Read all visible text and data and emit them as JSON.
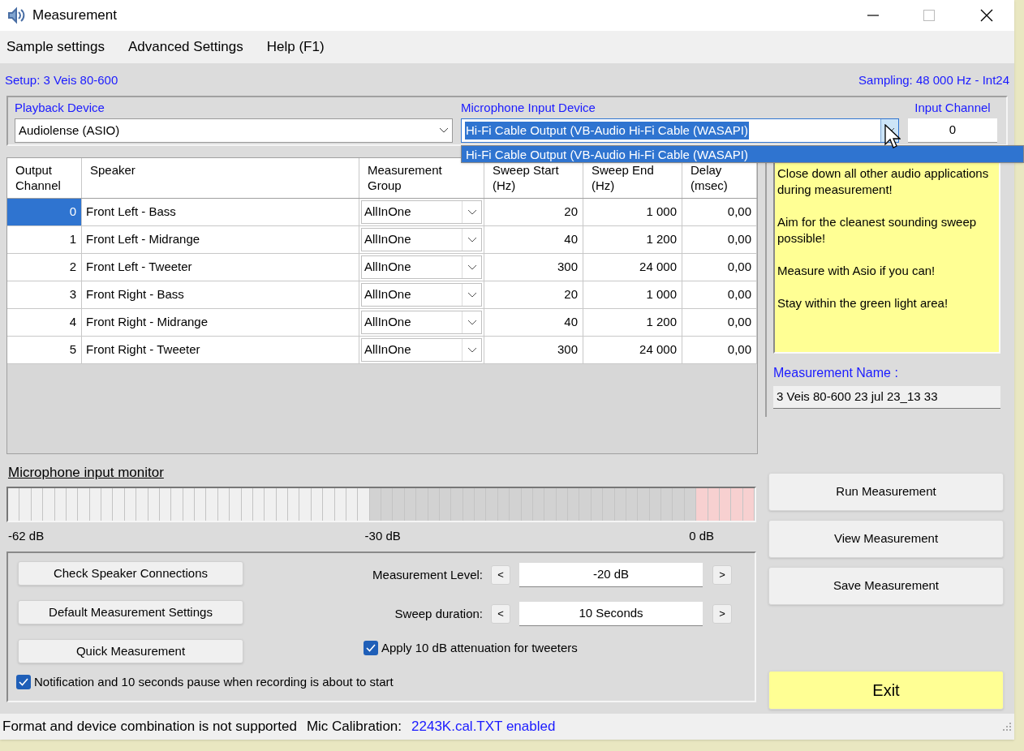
{
  "window": {
    "title": "Measurement"
  },
  "menu": [
    "Sample settings",
    "Advanced Settings",
    "Help (F1)"
  ],
  "setup_label": "Setup: 3 Veis 80-600",
  "sampling_label": "Sampling: 48 000 Hz - Int24",
  "playback_device": {
    "label": "Playback Device",
    "value": "Audiolense (ASIO)"
  },
  "mic_input_device": {
    "label": "Microphone Input Device",
    "value": "Hi-Fi Cable Output (VB-Audio Hi-Fi Cable (WASAPI)",
    "expanded": true,
    "options": [
      {
        "label": "Hi-Fi Cable Output (VB-Audio Hi-Fi Cable (WASAPI)",
        "selected": true
      }
    ]
  },
  "input_channel": {
    "label": "Input Channel",
    "value": "0"
  },
  "table": {
    "columns": [
      "Output Channel",
      "Speaker",
      "Measurement Group",
      "Sweep Start (Hz)",
      "Sweep End (Hz)",
      "Delay (msec)"
    ],
    "rows": [
      {
        "channel": "0",
        "speaker": "Front Left - Bass",
        "group": "AllInOne",
        "sweep_start": "20",
        "sweep_end": "1 000",
        "delay": "0,00",
        "selected": true
      },
      {
        "channel": "1",
        "speaker": "Front Left - Midrange",
        "group": "AllInOne",
        "sweep_start": "40",
        "sweep_end": "1 200",
        "delay": "0,00",
        "selected": false
      },
      {
        "channel": "2",
        "speaker": "Front Left - Tweeter",
        "group": "AllInOne",
        "sweep_start": "300",
        "sweep_end": "24 000",
        "delay": "0,00",
        "selected": false
      },
      {
        "channel": "3",
        "speaker": "Front Right - Bass",
        "group": "AllInOne",
        "sweep_start": "20",
        "sweep_end": "1 000",
        "delay": "0,00",
        "selected": false
      },
      {
        "channel": "4",
        "speaker": "Front Right - Midrange",
        "group": "AllInOne",
        "sweep_start": "40",
        "sweep_end": "1 200",
        "delay": "0,00",
        "selected": false
      },
      {
        "channel": "5",
        "speaker": "Front Right - Tweeter",
        "group": "AllInOne",
        "sweep_start": "300",
        "sweep_end": "24 000",
        "delay": "0,00",
        "selected": false
      }
    ]
  },
  "notes": [
    "Close down all other audio applications during measurement!",
    "Aim for the cleanest sounding sweep possible!",
    "Measure with Asio if you can!",
    "Stay within the green light area!"
  ],
  "measurement_name": {
    "label": "Measurement Name :",
    "value": "3 Veis 80-600 23 jul 23_13 33"
  },
  "monitor": {
    "title": "Microphone input monitor",
    "scale": [
      "-62 dB",
      "-30 dB",
      "0 dB"
    ]
  },
  "left_buttons": [
    "Check Speaker Connections",
    "Default Measurement Settings",
    "Quick Measurement"
  ],
  "steppers": [
    {
      "label": "Measurement Level:",
      "value": "-20 dB",
      "decrease": "<",
      "increase": ">"
    },
    {
      "label": "Sweep duration:",
      "value": "10 Seconds",
      "decrease": "<",
      "increase": ">"
    }
  ],
  "checkboxes": [
    {
      "label": "Apply 10 dB attenuation for tweeters",
      "checked": true
    },
    {
      "label": "Notification and 10 seconds pause when recording is about to start",
      "checked": true
    }
  ],
  "action_buttons": [
    {
      "label": "Run Measurement",
      "kind": "normal"
    },
    {
      "label": "View Measurement",
      "kind": "normal"
    },
    {
      "label": "Save Measurement",
      "kind": "normal"
    },
    {
      "label": "Exit",
      "kind": "exit"
    }
  ],
  "status_bar": {
    "message": "Format and device combination is not supported",
    "calibration_label": "Mic Calibration:",
    "calibration_value": "2243K.cal.TXT enabled"
  }
}
